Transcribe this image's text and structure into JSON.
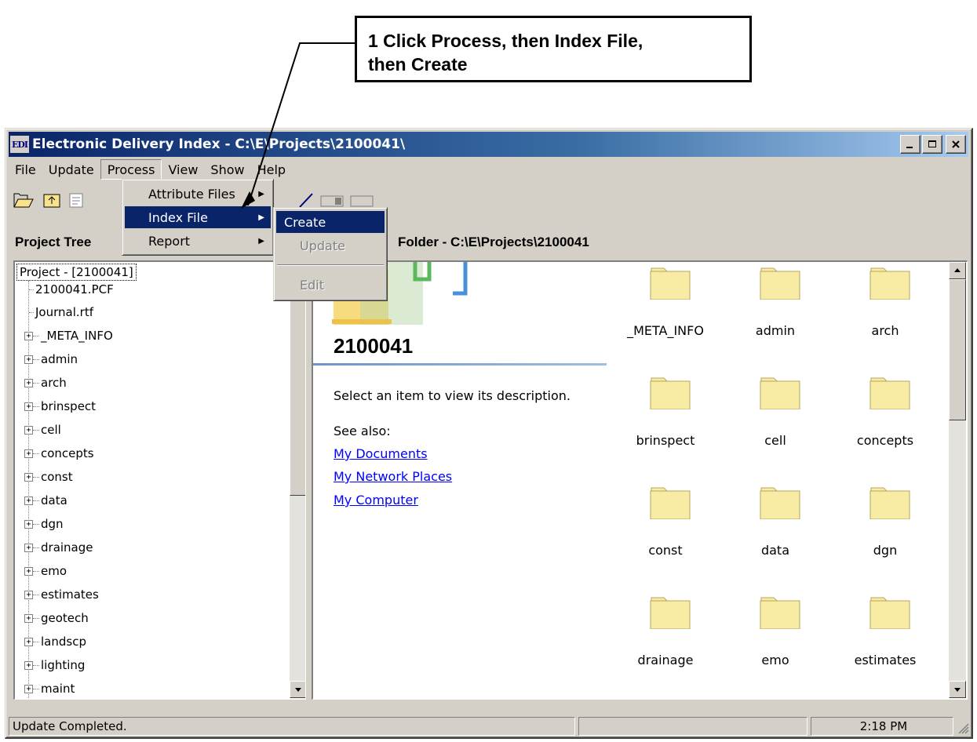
{
  "callout": {
    "line1": "1 Click Process, then Index File,",
    "line2": "then Create"
  },
  "window": {
    "logo": "EDI",
    "title": "Electronic Delivery Index - C:\\E\\Projects\\2100041\\",
    "minimize_icon": "minimize-icon",
    "maximize_icon": "maximize-icon",
    "close_icon": "close-icon"
  },
  "menubar": {
    "items": [
      "File",
      "Update",
      "Process",
      "View",
      "Show",
      "Help"
    ],
    "active": "Process"
  },
  "process_menu": {
    "items": [
      {
        "label": "Attribute Files",
        "submenu": true
      },
      {
        "label": "Index File",
        "submenu": true,
        "selected": true
      },
      {
        "label": "Report",
        "submenu": true
      }
    ]
  },
  "index_file_submenu": {
    "items": [
      {
        "label": "Create",
        "selected": true
      },
      {
        "label": "Update",
        "disabled": true
      },
      {
        "label": "Edit",
        "disabled": true
      }
    ]
  },
  "toolbar": {
    "icons": [
      "open-folder-icon",
      "up-folder-icon",
      "properties-icon",
      "edit-icon",
      "tile-icon",
      "cascade-icon"
    ]
  },
  "tree": {
    "header": "Project Tree",
    "root": "Project - [2100041]",
    "leaf_items": [
      "2100041.PCF",
      "Journal.rtf"
    ],
    "folders": [
      "_META_INFO",
      "admin",
      "arch",
      "brinspect",
      "cell",
      "concepts",
      "const",
      "data",
      "dgn",
      "drainage",
      "emo",
      "estimates",
      "geotech",
      "landscp",
      "lighting",
      "maint"
    ]
  },
  "content": {
    "header": "Folder - C:\\E\\Projects\\2100041",
    "folder_title": "2100041",
    "description": "Select an item to view its description.",
    "see_also": "See also:",
    "links": [
      "My Documents",
      "My Network Places",
      "My Computer"
    ],
    "folders": [
      "_META_INFO",
      "admin",
      "arch",
      "brinspect",
      "cell",
      "concepts",
      "const",
      "data",
      "dgn",
      "drainage",
      "emo",
      "estimates"
    ]
  },
  "statusbar": {
    "message": "Update Completed.",
    "time": "2:18 PM"
  },
  "colors": {
    "title_start": "#0a246a",
    "title_end": "#a6caf0",
    "menu_highlight": "#0a246a",
    "folder_fill": "#f8eca4"
  }
}
